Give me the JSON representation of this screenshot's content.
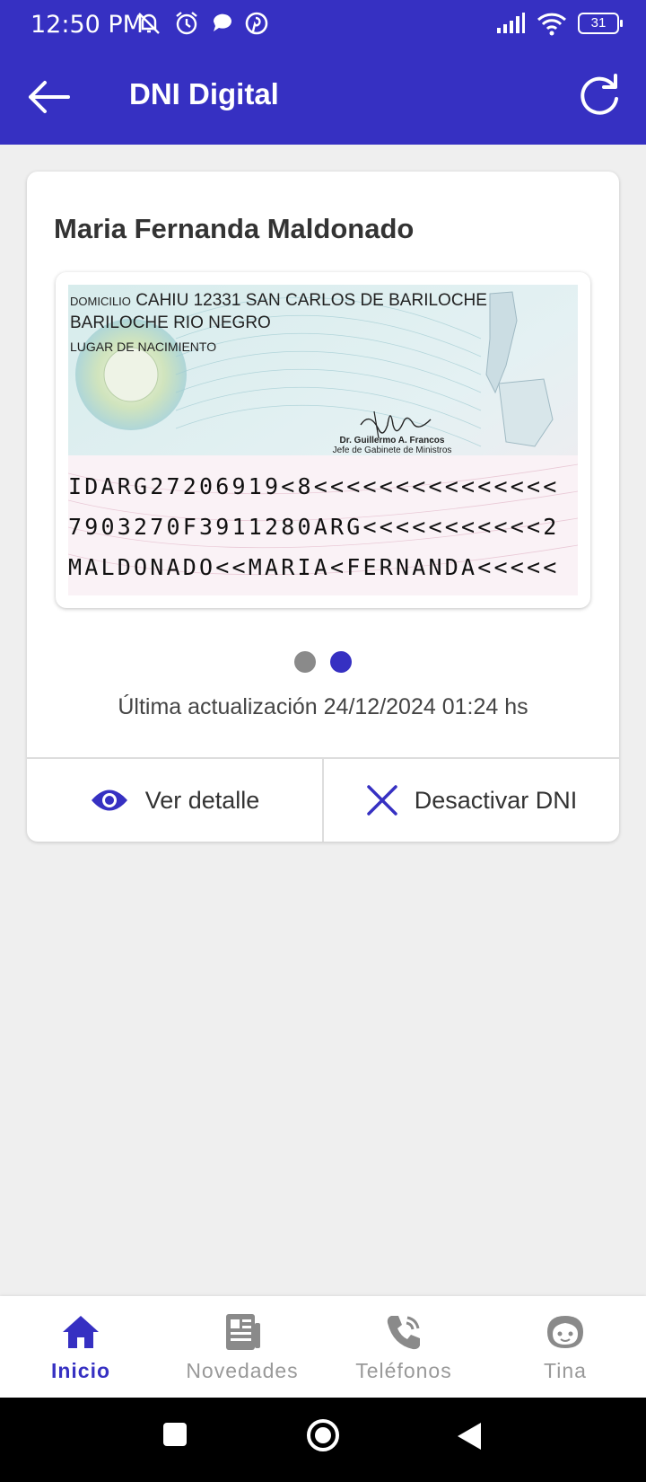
{
  "status_bar": {
    "time": "12:50 PM",
    "battery": "31",
    "icons": [
      "mute-bell-icon",
      "alarm-icon",
      "chat-bubble-icon",
      "pinterest-icon",
      "signal-icon",
      "wifi-icon",
      "battery-icon"
    ]
  },
  "app_bar": {
    "title": "DNI Digital",
    "back_icon": "arrow-left-icon",
    "refresh_icon": "refresh-icon"
  },
  "card": {
    "holder_name": "Maria Fernanda Maldonado",
    "dni_back": {
      "domicilio_label": "DOMICILIO",
      "domicilio_value": "CAHIU 12331 SAN CARLOS DE BARILOCHE BARILOCHE RIO NEGRO",
      "lugar_label": "LUGAR DE NACIMIENTO",
      "signer_name": "Dr. Guillermo A. Francos",
      "signer_title": "Jefe de Gabinete de Ministros",
      "mrz_line1": "IDARG27206919<8<<<<<<<<<<<<<<<",
      "mrz_line2": "7903270F3911280ARG<<<<<<<<<<<2",
      "mrz_line3": "MALDONADO<<MARIA<FERNANDA<<<<<"
    },
    "pager": {
      "pages": 2,
      "active_page": 2
    },
    "last_update": "Última actualización 24/12/2024 01:24 hs",
    "actions": {
      "detail_label": "Ver detalle",
      "deactivate_label": "Desactivar DNI"
    }
  },
  "bottom_nav": {
    "items": [
      {
        "label": "Inicio",
        "icon": "home-icon",
        "active": true
      },
      {
        "label": "Novedades",
        "icon": "newspaper-icon",
        "active": false
      },
      {
        "label": "Teléfonos",
        "icon": "phone-icon",
        "active": false
      },
      {
        "label": "Tina",
        "icon": "tina-face-icon",
        "active": false
      }
    ]
  },
  "colors": {
    "primary": "#3630c2",
    "inactive_dot": "#8a8a8a",
    "inactive_nav": "#999999",
    "background": "#efefef"
  }
}
